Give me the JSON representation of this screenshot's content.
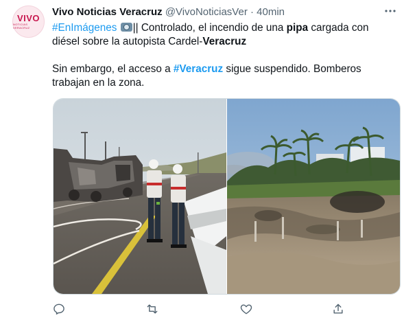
{
  "account": {
    "avatar_text": "VIVO",
    "avatar_subtext": "NOTICIAS VERACRUZ",
    "name": "Vivo Noticias Veracruz",
    "handle": "@VivoNoticiasVer",
    "separator": "·",
    "time": "40min"
  },
  "tweet": {
    "hashtag_1": "#EnImágenes",
    "text_1": "|| Controlado, el incendio de una",
    "bold_1": "pipa",
    "text_2": "cargada con diésel sobre la autopista Cardel-",
    "bold_2": "Veracruz",
    "text_3": "Sin embargo, el acceso a",
    "hashtag_2": "#Veracruz",
    "text_4": "sigue suspendido. Bomberos trabajan en la zona."
  },
  "icons": {
    "more": "more-icon",
    "camera": "camera-icon",
    "reply": "reply-icon",
    "retweet": "retweet-icon",
    "like": "like-icon",
    "share": "share-icon"
  },
  "colors": {
    "link": "#1d9bf0",
    "text": "#0f1419",
    "muted": "#536471",
    "brand": "#c8174e"
  }
}
